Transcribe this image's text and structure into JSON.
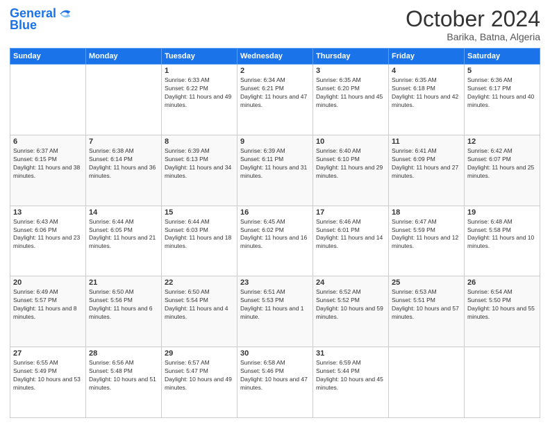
{
  "header": {
    "logo_line1": "General",
    "logo_line2": "Blue",
    "month": "October 2024",
    "location": "Barika, Batna, Algeria"
  },
  "weekdays": [
    "Sunday",
    "Monday",
    "Tuesday",
    "Wednesday",
    "Thursday",
    "Friday",
    "Saturday"
  ],
  "weeks": [
    [
      {
        "day": "",
        "sunrise": "",
        "sunset": "",
        "daylight": ""
      },
      {
        "day": "",
        "sunrise": "",
        "sunset": "",
        "daylight": ""
      },
      {
        "day": "1",
        "sunrise": "Sunrise: 6:33 AM",
        "sunset": "Sunset: 6:22 PM",
        "daylight": "Daylight: 11 hours and 49 minutes."
      },
      {
        "day": "2",
        "sunrise": "Sunrise: 6:34 AM",
        "sunset": "Sunset: 6:21 PM",
        "daylight": "Daylight: 11 hours and 47 minutes."
      },
      {
        "day": "3",
        "sunrise": "Sunrise: 6:35 AM",
        "sunset": "Sunset: 6:20 PM",
        "daylight": "Daylight: 11 hours and 45 minutes."
      },
      {
        "day": "4",
        "sunrise": "Sunrise: 6:35 AM",
        "sunset": "Sunset: 6:18 PM",
        "daylight": "Daylight: 11 hours and 42 minutes."
      },
      {
        "day": "5",
        "sunrise": "Sunrise: 6:36 AM",
        "sunset": "Sunset: 6:17 PM",
        "daylight": "Daylight: 11 hours and 40 minutes."
      }
    ],
    [
      {
        "day": "6",
        "sunrise": "Sunrise: 6:37 AM",
        "sunset": "Sunset: 6:15 PM",
        "daylight": "Daylight: 11 hours and 38 minutes."
      },
      {
        "day": "7",
        "sunrise": "Sunrise: 6:38 AM",
        "sunset": "Sunset: 6:14 PM",
        "daylight": "Daylight: 11 hours and 36 minutes."
      },
      {
        "day": "8",
        "sunrise": "Sunrise: 6:39 AM",
        "sunset": "Sunset: 6:13 PM",
        "daylight": "Daylight: 11 hours and 34 minutes."
      },
      {
        "day": "9",
        "sunrise": "Sunrise: 6:39 AM",
        "sunset": "Sunset: 6:11 PM",
        "daylight": "Daylight: 11 hours and 31 minutes."
      },
      {
        "day": "10",
        "sunrise": "Sunrise: 6:40 AM",
        "sunset": "Sunset: 6:10 PM",
        "daylight": "Daylight: 11 hours and 29 minutes."
      },
      {
        "day": "11",
        "sunrise": "Sunrise: 6:41 AM",
        "sunset": "Sunset: 6:09 PM",
        "daylight": "Daylight: 11 hours and 27 minutes."
      },
      {
        "day": "12",
        "sunrise": "Sunrise: 6:42 AM",
        "sunset": "Sunset: 6:07 PM",
        "daylight": "Daylight: 11 hours and 25 minutes."
      }
    ],
    [
      {
        "day": "13",
        "sunrise": "Sunrise: 6:43 AM",
        "sunset": "Sunset: 6:06 PM",
        "daylight": "Daylight: 11 hours and 23 minutes."
      },
      {
        "day": "14",
        "sunrise": "Sunrise: 6:44 AM",
        "sunset": "Sunset: 6:05 PM",
        "daylight": "Daylight: 11 hours and 21 minutes."
      },
      {
        "day": "15",
        "sunrise": "Sunrise: 6:44 AM",
        "sunset": "Sunset: 6:03 PM",
        "daylight": "Daylight: 11 hours and 18 minutes."
      },
      {
        "day": "16",
        "sunrise": "Sunrise: 6:45 AM",
        "sunset": "Sunset: 6:02 PM",
        "daylight": "Daylight: 11 hours and 16 minutes."
      },
      {
        "day": "17",
        "sunrise": "Sunrise: 6:46 AM",
        "sunset": "Sunset: 6:01 PM",
        "daylight": "Daylight: 11 hours and 14 minutes."
      },
      {
        "day": "18",
        "sunrise": "Sunrise: 6:47 AM",
        "sunset": "Sunset: 5:59 PM",
        "daylight": "Daylight: 11 hours and 12 minutes."
      },
      {
        "day": "19",
        "sunrise": "Sunrise: 6:48 AM",
        "sunset": "Sunset: 5:58 PM",
        "daylight": "Daylight: 11 hours and 10 minutes."
      }
    ],
    [
      {
        "day": "20",
        "sunrise": "Sunrise: 6:49 AM",
        "sunset": "Sunset: 5:57 PM",
        "daylight": "Daylight: 11 hours and 8 minutes."
      },
      {
        "day": "21",
        "sunrise": "Sunrise: 6:50 AM",
        "sunset": "Sunset: 5:56 PM",
        "daylight": "Daylight: 11 hours and 6 minutes."
      },
      {
        "day": "22",
        "sunrise": "Sunrise: 6:50 AM",
        "sunset": "Sunset: 5:54 PM",
        "daylight": "Daylight: 11 hours and 4 minutes."
      },
      {
        "day": "23",
        "sunrise": "Sunrise: 6:51 AM",
        "sunset": "Sunset: 5:53 PM",
        "daylight": "Daylight: 11 hours and 1 minute."
      },
      {
        "day": "24",
        "sunrise": "Sunrise: 6:52 AM",
        "sunset": "Sunset: 5:52 PM",
        "daylight": "Daylight: 10 hours and 59 minutes."
      },
      {
        "day": "25",
        "sunrise": "Sunrise: 6:53 AM",
        "sunset": "Sunset: 5:51 PM",
        "daylight": "Daylight: 10 hours and 57 minutes."
      },
      {
        "day": "26",
        "sunrise": "Sunrise: 6:54 AM",
        "sunset": "Sunset: 5:50 PM",
        "daylight": "Daylight: 10 hours and 55 minutes."
      }
    ],
    [
      {
        "day": "27",
        "sunrise": "Sunrise: 6:55 AM",
        "sunset": "Sunset: 5:49 PM",
        "daylight": "Daylight: 10 hours and 53 minutes."
      },
      {
        "day": "28",
        "sunrise": "Sunrise: 6:56 AM",
        "sunset": "Sunset: 5:48 PM",
        "daylight": "Daylight: 10 hours and 51 minutes."
      },
      {
        "day": "29",
        "sunrise": "Sunrise: 6:57 AM",
        "sunset": "Sunset: 5:47 PM",
        "daylight": "Daylight: 10 hours and 49 minutes."
      },
      {
        "day": "30",
        "sunrise": "Sunrise: 6:58 AM",
        "sunset": "Sunset: 5:46 PM",
        "daylight": "Daylight: 10 hours and 47 minutes."
      },
      {
        "day": "31",
        "sunrise": "Sunrise: 6:59 AM",
        "sunset": "Sunset: 5:44 PM",
        "daylight": "Daylight: 10 hours and 45 minutes."
      },
      {
        "day": "",
        "sunrise": "",
        "sunset": "",
        "daylight": ""
      },
      {
        "day": "",
        "sunrise": "",
        "sunset": "",
        "daylight": ""
      }
    ]
  ]
}
